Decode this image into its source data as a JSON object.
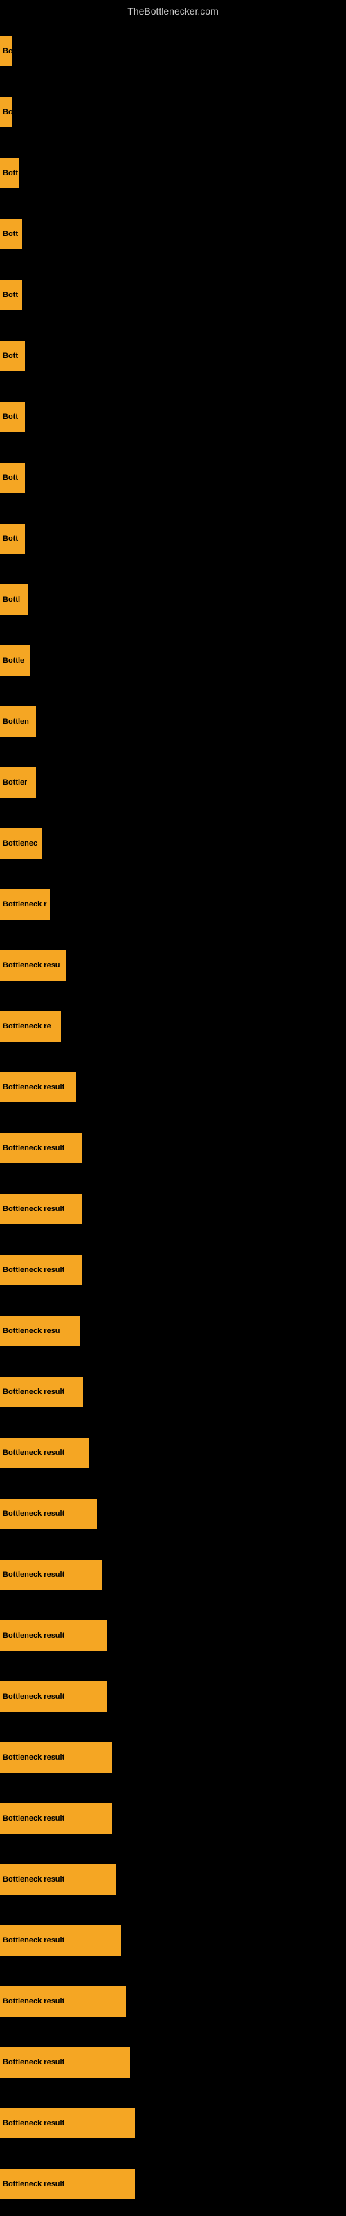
{
  "site": {
    "title": "TheBottlenecker.com"
  },
  "bars": [
    {
      "label": "Bo",
      "width": 18
    },
    {
      "label": "Bo",
      "width": 18
    },
    {
      "label": "Bott",
      "width": 28
    },
    {
      "label": "Bott",
      "width": 32
    },
    {
      "label": "Bott",
      "width": 32
    },
    {
      "label": "Bott",
      "width": 36
    },
    {
      "label": "Bott",
      "width": 36
    },
    {
      "label": "Bott",
      "width": 36
    },
    {
      "label": "Bott",
      "width": 36
    },
    {
      "label": "Bottl",
      "width": 40
    },
    {
      "label": "Bottle",
      "width": 44
    },
    {
      "label": "Bottlen",
      "width": 52
    },
    {
      "label": "Bottler",
      "width": 52
    },
    {
      "label": "Bottlenec",
      "width": 60
    },
    {
      "label": "Bottleneck r",
      "width": 72
    },
    {
      "label": "Bottleneck resu",
      "width": 95
    },
    {
      "label": "Bottleneck re",
      "width": 88
    },
    {
      "label": "Bottleneck result",
      "width": 110
    },
    {
      "label": "Bottleneck result",
      "width": 118
    },
    {
      "label": "Bottleneck result",
      "width": 118
    },
    {
      "label": "Bottleneck result",
      "width": 118
    },
    {
      "label": "Bottleneck resu",
      "width": 115
    },
    {
      "label": "Bottleneck result",
      "width": 120
    },
    {
      "label": "Bottleneck result",
      "width": 128
    },
    {
      "label": "Bottleneck result",
      "width": 140
    },
    {
      "label": "Bottleneck result",
      "width": 148
    },
    {
      "label": "Bottleneck result",
      "width": 155
    },
    {
      "label": "Bottleneck result",
      "width": 155
    },
    {
      "label": "Bottleneck result",
      "width": 162
    },
    {
      "label": "Bottleneck result",
      "width": 162
    },
    {
      "label": "Bottleneck result",
      "width": 168
    },
    {
      "label": "Bottleneck result",
      "width": 175
    },
    {
      "label": "Bottleneck result",
      "width": 182
    },
    {
      "label": "Bottleneck result",
      "width": 188
    },
    {
      "label": "Bottleneck result",
      "width": 195
    },
    {
      "label": "Bottleneck result",
      "width": 195
    }
  ]
}
